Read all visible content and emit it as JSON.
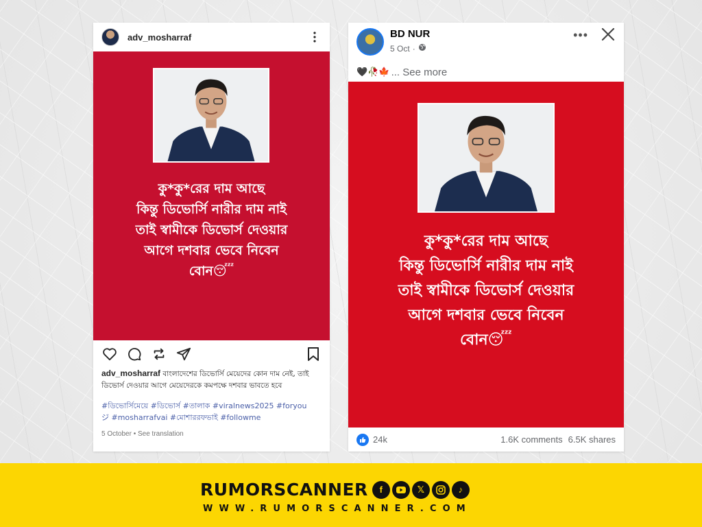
{
  "instagram": {
    "username": "adv_mosharraf",
    "post_text_lines": [
      "কু*কু*রের দাম আছে",
      "কিন্তু  ডিভোর্সি নারীর দাম নাই",
      "তাই স্বামীকে ডিভোর্স দেওয়ার",
      "আগে দশবার ভেবে নিবেন",
      "বোন😴"
    ],
    "caption_username": "adv_mosharraf",
    "caption_text": "বাংলাদেশের ডিভোর্সি মেয়েদের কোন দাম নেই, তাই ডিভোর্স দেওয়ার আগে মেয়েদেরকে কমপক্ষে দশবার ভাবতে হবে",
    "hashtags_line1": "#ডিভোর্সিমেয়ে #ডিভোর্স #তালাক #viralnews2025 #foryou",
    "hashtags_line2": "ジ #mosharrafvai #মোশাররফভাই #followme",
    "date": "5 October",
    "see_translation": "See translation"
  },
  "facebook": {
    "page_name": "BD NUR",
    "date": "5 Oct",
    "separator": "·",
    "description_emojis": "🖤🥀🍁",
    "see_more": "... See more",
    "post_text_lines": [
      "কু*কু*রের দাম আছে",
      "কিন্তু  ডিভোর্সি নারীর দাম নাই",
      "তাই স্বামীকে ডিভোর্স দেওয়ার",
      "আগে দশবার ভেবে নিবেন",
      "বোন😴"
    ],
    "reactions": "24k",
    "comments": "1.6K comments",
    "shares": "6.5K shares"
  },
  "brand": {
    "name": "RUMORSCANNER",
    "url": "WWW.RUMORSCANNER.COM",
    "social_icons": [
      "facebook-icon",
      "youtube-icon",
      "x-icon",
      "instagram-icon",
      "tiktok-icon"
    ]
  },
  "colors": {
    "ig_post_bg": "#c5102f",
    "fb_post_bg": "#d60d1f",
    "brand_bar": "#fcd602",
    "fb_blue": "#1877f2"
  }
}
